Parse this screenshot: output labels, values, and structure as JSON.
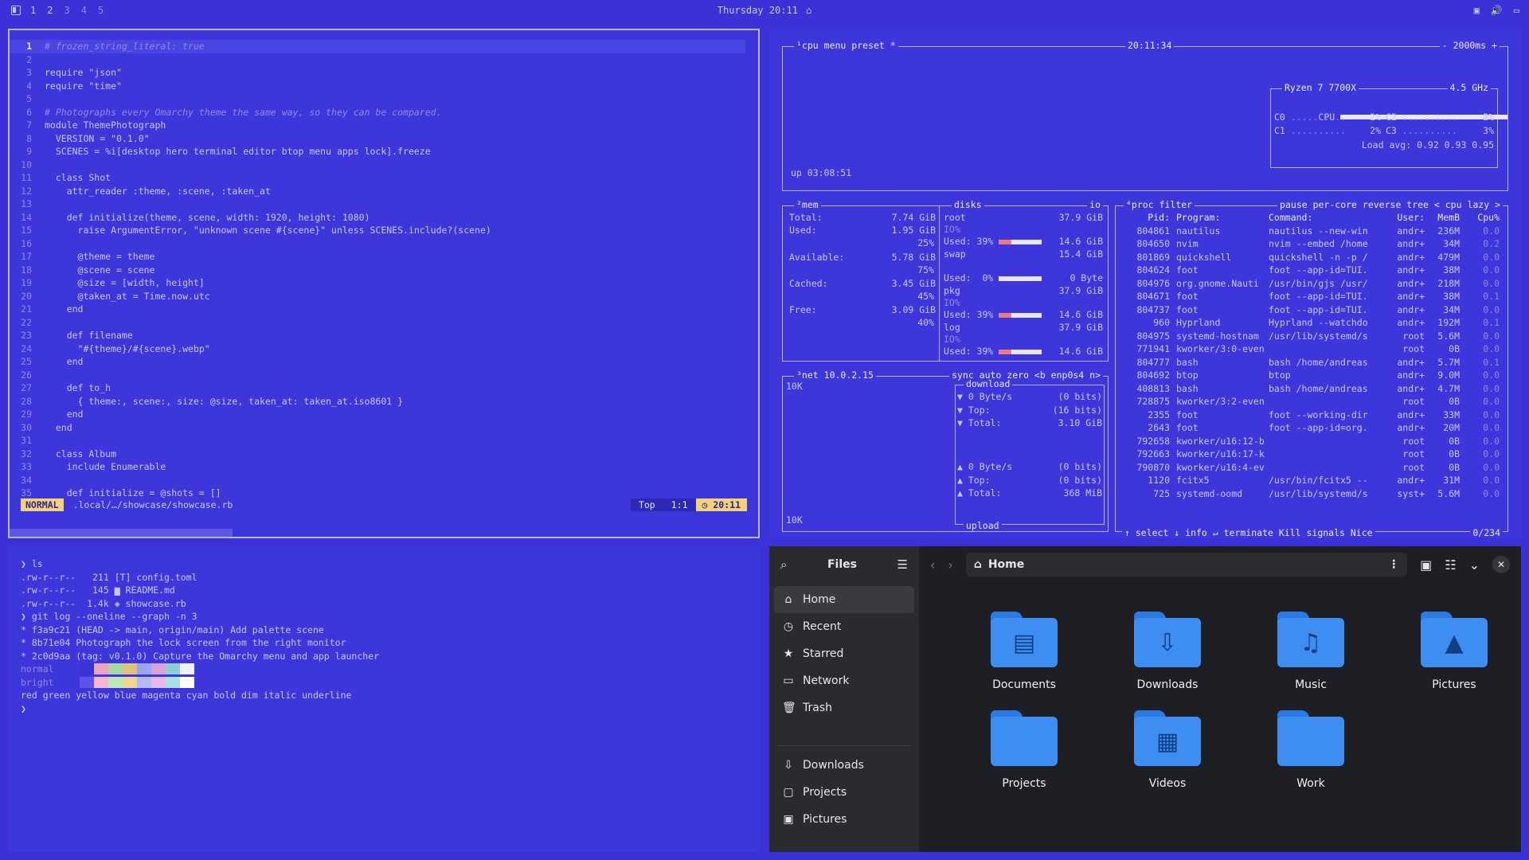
{
  "topbar": {
    "workspaces": [
      "1",
      "2",
      "3",
      "4",
      "5"
    ],
    "clock": "Thursday 20:11"
  },
  "editor": {
    "lines": [
      {
        "n": "1",
        "t": "# frozen_string_literal: true",
        "cls": "cm"
      },
      {
        "n": "2",
        "t": ""
      },
      {
        "n": "3",
        "t": "require \"json\""
      },
      {
        "n": "4",
        "t": "require \"time\""
      },
      {
        "n": "5",
        "t": ""
      },
      {
        "n": "6",
        "t": "# Photographs every Omarchy theme the same way, so they can be compared.",
        "cls": "cm"
      },
      {
        "n": "7",
        "t": "module ThemePhotograph"
      },
      {
        "n": "8",
        "t": "  VERSION = \"0.1.0\""
      },
      {
        "n": "9",
        "t": "  SCENES = %i[desktop hero terminal editor btop menu apps lock].freeze"
      },
      {
        "n": "10",
        "t": ""
      },
      {
        "n": "11",
        "t": "  class Shot"
      },
      {
        "n": "12",
        "t": "    attr_reader :theme, :scene, :taken_at"
      },
      {
        "n": "13",
        "t": ""
      },
      {
        "n": "14",
        "t": "    def initialize(theme, scene, width: 1920, height: 1080)"
      },
      {
        "n": "15",
        "t": "      raise ArgumentError, \"unknown scene #{scene}\" unless SCENES.include?(scene)"
      },
      {
        "n": "16",
        "t": ""
      },
      {
        "n": "17",
        "t": "      @theme = theme"
      },
      {
        "n": "18",
        "t": "      @scene = scene"
      },
      {
        "n": "19",
        "t": "      @size = [width, height]"
      },
      {
        "n": "20",
        "t": "      @taken_at = Time.now.utc"
      },
      {
        "n": "21",
        "t": "    end"
      },
      {
        "n": "22",
        "t": ""
      },
      {
        "n": "23",
        "t": "    def filename"
      },
      {
        "n": "24",
        "t": "      \"#{theme}/#{scene}.webp\""
      },
      {
        "n": "25",
        "t": "    end"
      },
      {
        "n": "26",
        "t": ""
      },
      {
        "n": "27",
        "t": "    def to_h"
      },
      {
        "n": "28",
        "t": "      { theme:, scene:, size: @size, taken_at: taken_at.iso8601 }"
      },
      {
        "n": "29",
        "t": "    end"
      },
      {
        "n": "30",
        "t": "  end"
      },
      {
        "n": "31",
        "t": ""
      },
      {
        "n": "32",
        "t": "  class Album"
      },
      {
        "n": "33",
        "t": "    include Enumerable"
      },
      {
        "n": "34",
        "t": ""
      },
      {
        "n": "35",
        "t": "    def initialize = @shots = []"
      }
    ],
    "status": {
      "mode": "NORMAL",
      "path": ".local/…/showcase/showcase.rb",
      "scroll": "Top",
      "pos": "1:1",
      "time": "20:11"
    }
  },
  "btop": {
    "cpu": {
      "title_left": "¹cpu",
      "menu": "menu",
      "preset": "preset *",
      "clock": "20:11:34",
      "interval": "- 2000ms +",
      "model": "Ryzen 7 7700X",
      "freq": "4.5 GHz",
      "cpu_label": "CPU",
      "cpu_pct": "2%",
      "cores": [
        {
          "name": "C0",
          "pct": "2%"
        },
        {
          "name": "C1",
          "pct": "2%"
        },
        {
          "name": "C2",
          "pct": "0%"
        },
        {
          "name": "C3",
          "pct": "3%"
        }
      ],
      "load": "Load avg: 0.92 0.93 0.95",
      "uptime": "up 03:08:51"
    },
    "mem": {
      "title": "²mem",
      "total_label": "Total:",
      "total": "7.74 GiB",
      "used_label": "Used:",
      "used": "1.95 GiB",
      "used_pct": "25%",
      "avail_label": "Available:",
      "avail": "5.78 GiB",
      "avail_pct": "75%",
      "cached_label": "Cached:",
      "cached": "3.45 GiB",
      "cached_pct": "45%",
      "free_label": "Free:",
      "free": "3.09 GiB",
      "free_pct": "40%"
    },
    "disks": {
      "title": "disks",
      "io": "io",
      "items": [
        {
          "name": "root",
          "size": "37.9 GiB",
          "io": "IO%",
          "used": "Used: 39%",
          "usedsz": "14.6 GiB"
        },
        {
          "name": "swap",
          "size": "15.4 GiB",
          "io": "",
          "used": "Used:  0%",
          "usedsz": "0 Byte"
        },
        {
          "name": "pkg",
          "size": "37.9 GiB",
          "io": "IO%",
          "used": "Used: 39%",
          "usedsz": "14.6 GiB"
        },
        {
          "name": "log",
          "size": "37.9 GiB",
          "io": "IO%",
          "used": "Used: 39%",
          "usedsz": "14.6 GiB"
        }
      ]
    },
    "net": {
      "title": "³net",
      "ip": "10.0.2.15",
      "opts": "sync auto zero <b enp0s4 n>",
      "scale_top": "10K",
      "scale_bot": "10K",
      "download": "download",
      "dl": [
        {
          "k": "▼ 0 Byte/s",
          "v": "(0 bits)"
        },
        {
          "k": "▼ Top:",
          "v": "(16 bits)"
        },
        {
          "k": "▼ Total:",
          "v": "3.10 GiB"
        }
      ],
      "ul": [
        {
          "k": "▲ 0 Byte/s",
          "v": "(0 bits)"
        },
        {
          "k": "▲ Top:",
          "v": "(0 bits)"
        },
        {
          "k": "▲ Total:",
          "v": "368 MiB"
        }
      ],
      "upload": "upload"
    },
    "proc": {
      "title": "⁴proc",
      "tabs": "filter",
      "opts": "pause per-core reverse tree < cpu lazy >",
      "header": {
        "pid": "Pid:",
        "prog": "Program:",
        "cmd": "Command:",
        "user": "User:",
        "mem": "MemB",
        "cpu": "Cpu%"
      },
      "rows": [
        {
          "pid": "804861",
          "prog": "nautilus",
          "cmd": "nautilus --new-win",
          "user": "andr+",
          "mem": "236M",
          "cpu": "0.0"
        },
        {
          "pid": "804650",
          "prog": "nvim",
          "cmd": "nvim --embed /home",
          "user": "andr+",
          "mem": "34M",
          "cpu": "0.2"
        },
        {
          "pid": "801869",
          "prog": "quickshell",
          "cmd": "quickshell -n -p /",
          "user": "andr+",
          "mem": "479M",
          "cpu": "0.0"
        },
        {
          "pid": "804624",
          "prog": "foot",
          "cmd": "foot --app-id=TUI.",
          "user": "andr+",
          "mem": "38M",
          "cpu": "0.0"
        },
        {
          "pid": "804976",
          "prog": "org.gnome.Nauti",
          "cmd": "/usr/bin/gjs /usr/",
          "user": "andr+",
          "mem": "218M",
          "cpu": "0.0"
        },
        {
          "pid": "804671",
          "prog": "foot",
          "cmd": "foot --app-id=TUI.",
          "user": "andr+",
          "mem": "38M",
          "cpu": "0.1"
        },
        {
          "pid": "804737",
          "prog": "foot",
          "cmd": "foot --app-id=TUI.",
          "user": "andr+",
          "mem": "34M",
          "cpu": "0.0"
        },
        {
          "pid": "960",
          "prog": "Hyprland",
          "cmd": "Hyprland --watchdo",
          "user": "andr+",
          "mem": "192M",
          "cpu": "0.1"
        },
        {
          "pid": "804975",
          "prog": "systemd-hostnam",
          "cmd": "/usr/lib/systemd/s",
          "user": "root",
          "mem": "5.6M",
          "cpu": "0.0"
        },
        {
          "pid": "771941",
          "prog": "kworker/3:0-even",
          "cmd": "",
          "user": "root",
          "mem": "0B",
          "cpu": "0.0"
        },
        {
          "pid": "804777",
          "prog": "bash",
          "cmd": "bash /home/andreas",
          "user": "andr+",
          "mem": "5.7M",
          "cpu": "0.1"
        },
        {
          "pid": "804692",
          "prog": "btop",
          "cmd": "btop",
          "user": "andr+",
          "mem": "9.0M",
          "cpu": "0.0"
        },
        {
          "pid": "408813",
          "prog": "bash",
          "cmd": "bash /home/andreas",
          "user": "andr+",
          "mem": "4.7M",
          "cpu": "0.0"
        },
        {
          "pid": "728875",
          "prog": "kworker/3:2-even",
          "cmd": "",
          "user": "root",
          "mem": "0B",
          "cpu": "0.0"
        },
        {
          "pid": "2355",
          "prog": "foot",
          "cmd": "foot --working-dir",
          "user": "andr+",
          "mem": "33M",
          "cpu": "0.0"
        },
        {
          "pid": "2643",
          "prog": "foot",
          "cmd": "foot --app-id=org.",
          "user": "andr+",
          "mem": "20M",
          "cpu": "0.0"
        },
        {
          "pid": "792658",
          "prog": "kworker/u16:12-b",
          "cmd": "",
          "user": "root",
          "mem": "0B",
          "cpu": "0.0"
        },
        {
          "pid": "792663",
          "prog": "kworker/u16:17-k",
          "cmd": "",
          "user": "root",
          "mem": "0B",
          "cpu": "0.0"
        },
        {
          "pid": "790870",
          "prog": "kworker/u16:4-ev",
          "cmd": "",
          "user": "root",
          "mem": "0B",
          "cpu": "0.0"
        },
        {
          "pid": "1120",
          "prog": "fcitx5",
          "cmd": "/usr/bin/fcitx5 --",
          "user": "andr+",
          "mem": "31M",
          "cpu": "0.0"
        },
        {
          "pid": "725",
          "prog": "systemd-oomd",
          "cmd": "/usr/lib/systemd/s",
          "user": "syst+",
          "mem": "5.6M",
          "cpu": "0.0"
        }
      ],
      "footer": "↑ select ↓ info ↵ terminate Kill signals Nice",
      "count": "0/234"
    }
  },
  "terminal": {
    "lines": [
      "❯ ls",
      ".rw-r--r--   211 [T] config.toml",
      ".rw-r--r--   145 ▆ README.md",
      ".rw-r--r--  1.4k ◈ showcase.rb",
      "❯ git log --oneline --graph -n 3",
      "* f3a9c21 (HEAD -> main, origin/main) Add palette scene",
      "* 8b71e04 Photograph the lock screen from the right monitor",
      "* 2c0d9aa (tag: v0.1.0) Capture the Omarchy menu and app launcher"
    ],
    "normal_label": "normal",
    "bright_label": "bright",
    "styles_line": "red green yellow blue magenta cyan bold dim italic underline",
    "prompt": "❯",
    "palette_normal": [
      "#3a32d6",
      "#e8a3c0",
      "#a7d7a0",
      "#d9c47a",
      "#9aa6f0",
      "#d7a3d9",
      "#8fd0d6",
      "#f0f0ff"
    ],
    "palette_bright": [
      "#5a55e6",
      "#f2b7cf",
      "#bde8b5",
      "#ead98f",
      "#b3bcf7",
      "#e6b9e8",
      "#a8e1e6",
      "#ffffff"
    ]
  },
  "files": {
    "title": "Files",
    "location": "Home",
    "sidebar": [
      {
        "label": "Home",
        "icon": "⌂",
        "active": true
      },
      {
        "label": "Recent",
        "icon": "◷"
      },
      {
        "label": "Starred",
        "icon": "★"
      },
      {
        "label": "Network",
        "icon": "▭"
      },
      {
        "label": "Trash",
        "icon": "🗑"
      }
    ],
    "sidebar2": [
      {
        "label": "Downloads",
        "icon": "⇩"
      },
      {
        "label": "Projects",
        "icon": "▢"
      },
      {
        "label": "Pictures",
        "icon": "▣"
      }
    ],
    "folders": [
      {
        "label": "Documents",
        "glyph": "▤"
      },
      {
        "label": "Downloads",
        "glyph": "⇩"
      },
      {
        "label": "Music",
        "glyph": "♫"
      },
      {
        "label": "Pictures",
        "glyph": "▲"
      },
      {
        "label": "Projects",
        "glyph": ""
      },
      {
        "label": "Videos",
        "glyph": "▦"
      },
      {
        "label": "Work",
        "glyph": ""
      }
    ]
  }
}
